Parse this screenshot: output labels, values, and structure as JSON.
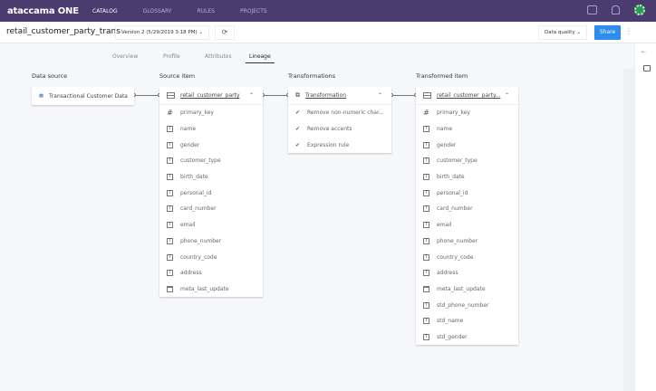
{
  "nav": {
    "logo": "ataccama ONE",
    "items": [
      "CATALOG",
      "GLOSSARY",
      "RULES",
      "PROJECTS"
    ],
    "active": "CATALOG"
  },
  "header": {
    "title": "retail_customer_party_trans",
    "version": "Version 2 (5/29/2019 3:18 PM) ⌄",
    "data_quality": "Data quality ⌄",
    "share": "Share"
  },
  "tabs": [
    "Overview",
    "Profile",
    "Attributes",
    "Lineage"
  ],
  "columns": {
    "data_source": "Data source",
    "source_item": "Source item",
    "transformations": "Transformations",
    "transformed_item": "Transformed item"
  },
  "data_source": {
    "label": "Transactional Customer Data"
  },
  "source_item": {
    "label": "retail_customer_party",
    "fields": [
      {
        "icon": "hash",
        "name": "primary_key"
      },
      {
        "icon": "text",
        "name": "name"
      },
      {
        "icon": "text",
        "name": "gender"
      },
      {
        "icon": "text",
        "name": "customer_type"
      },
      {
        "icon": "text",
        "name": "birth_date"
      },
      {
        "icon": "text",
        "name": "personal_id"
      },
      {
        "icon": "text",
        "name": "card_number"
      },
      {
        "icon": "text",
        "name": "email"
      },
      {
        "icon": "text",
        "name": "phone_number"
      },
      {
        "icon": "text",
        "name": "country_code"
      },
      {
        "icon": "text",
        "name": "address"
      },
      {
        "icon": "calendar",
        "name": "meta_last_update"
      }
    ]
  },
  "transformation": {
    "label": "Transformation",
    "steps": [
      "Remove non-numeric char...",
      "Remove accents",
      "Expression rule"
    ]
  },
  "transformed_item": {
    "label": "retail_customer_party...",
    "fields": [
      {
        "icon": "hash",
        "name": "primary_key"
      },
      {
        "icon": "text",
        "name": "name"
      },
      {
        "icon": "text",
        "name": "gender"
      },
      {
        "icon": "text",
        "name": "customer_type"
      },
      {
        "icon": "text",
        "name": "birth_date"
      },
      {
        "icon": "text",
        "name": "personal_id"
      },
      {
        "icon": "text",
        "name": "card_number"
      },
      {
        "icon": "text",
        "name": "email"
      },
      {
        "icon": "text",
        "name": "phone_number"
      },
      {
        "icon": "text",
        "name": "country_code"
      },
      {
        "icon": "text",
        "name": "address"
      },
      {
        "icon": "calendar",
        "name": "meta_last_update"
      },
      {
        "icon": "text",
        "name": "std_phone_number"
      },
      {
        "icon": "text",
        "name": "std_name"
      },
      {
        "icon": "text",
        "name": "std_gender"
      }
    ]
  },
  "colors": {
    "nav": "#4b3c70",
    "accent": "#2d8cf0"
  }
}
